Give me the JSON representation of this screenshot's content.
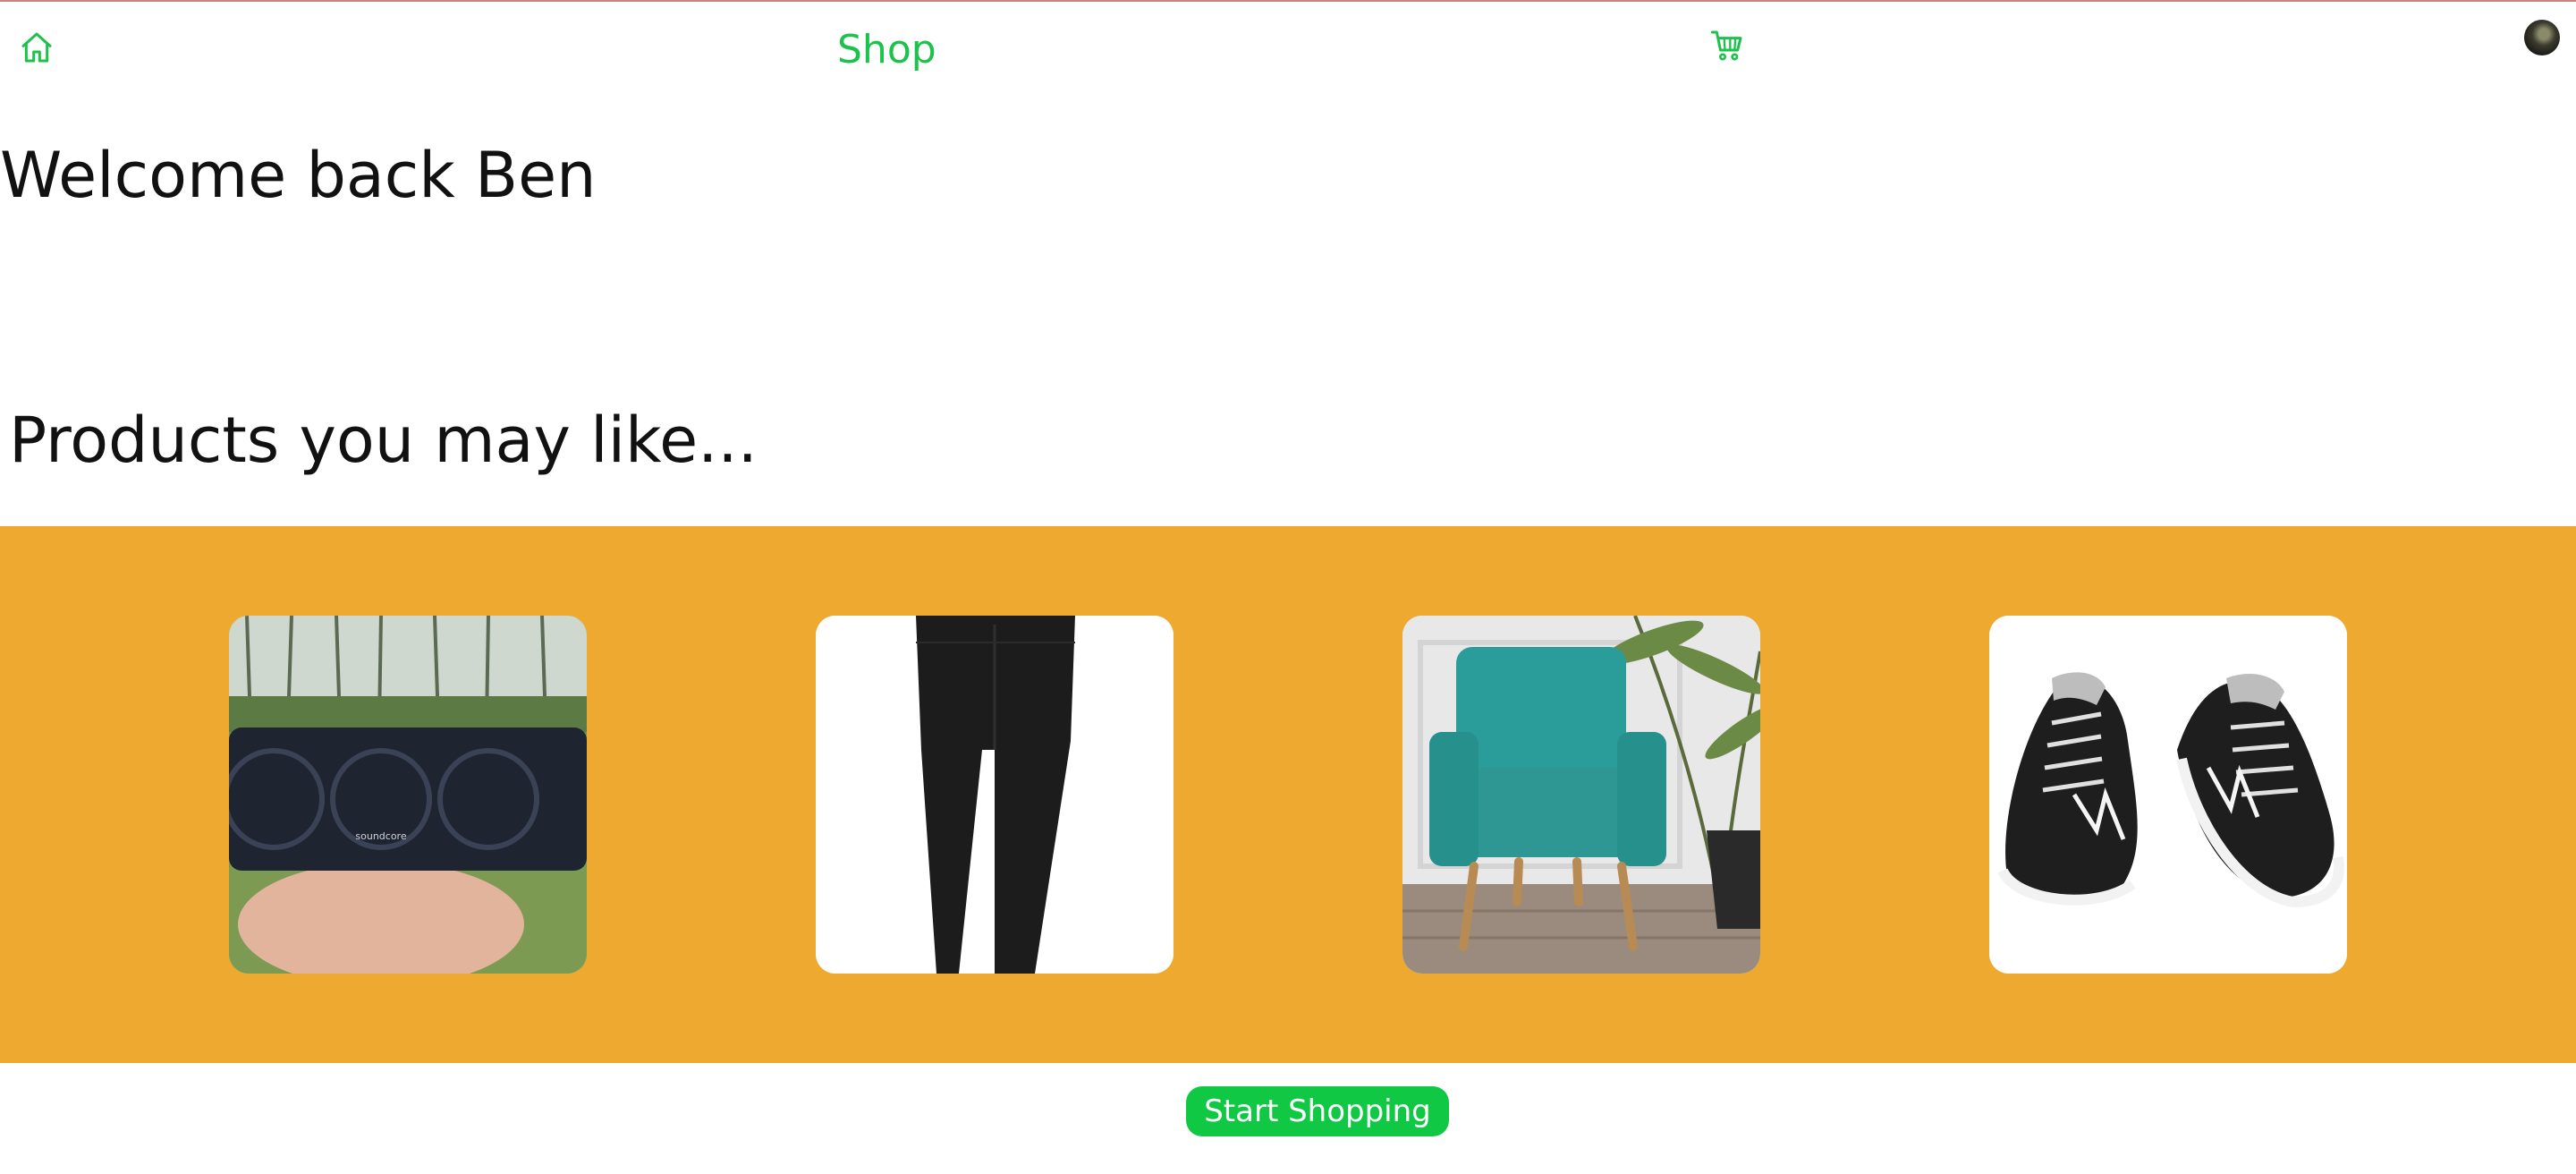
{
  "nav": {
    "home_icon": "home-icon",
    "shop_label": "Shop",
    "cart_icon": "cart-icon",
    "avatar_icon": "user-avatar"
  },
  "welcome": {
    "text": "Welcome back Ben"
  },
  "recommendations": {
    "title": "Products you may like...",
    "background_color": "#EEAA30",
    "products": [
      {
        "image": "speaker-image"
      },
      {
        "image": "pants-image"
      },
      {
        "image": "armchair-image"
      },
      {
        "image": "sneakers-image"
      }
    ]
  },
  "cta": {
    "label": "Start Shopping",
    "color": "#11C844"
  },
  "colors": {
    "accent": "#1DC24A"
  }
}
